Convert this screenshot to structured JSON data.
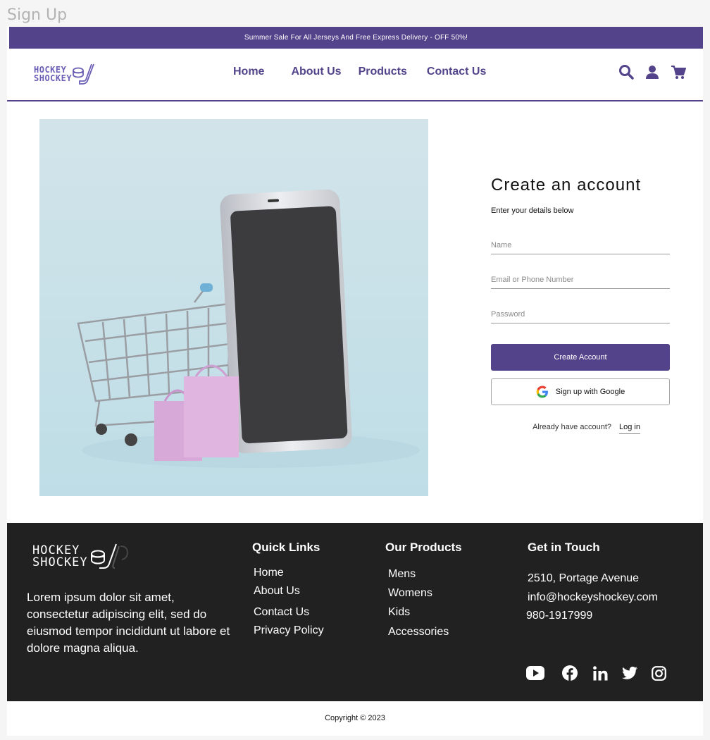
{
  "frame_label": "Sign Up",
  "promo": {
    "text": "Summer Sale For All Jerseys And Free Express Delivery - OFF 50%!"
  },
  "brand": {
    "line1": "HOCKEY",
    "line2": "SHOCKEY",
    "color": "#52438a"
  },
  "nav": [
    {
      "label": "Home"
    },
    {
      "label": "About Us"
    },
    {
      "label": "Products"
    },
    {
      "label": "Contact Us"
    }
  ],
  "header_icons": [
    "search-icon",
    "user-icon",
    "cart-icon"
  ],
  "signup": {
    "title": "Create an account",
    "subtitle": "Enter your details below",
    "name_placeholder": "Name",
    "email_placeholder": "Email or Phone Number",
    "password_placeholder": "Password",
    "create_button": "Create Account",
    "google_button": "Sign up with Google",
    "login_prompt": "Already have account?",
    "login_link": "Log in"
  },
  "footer": {
    "description": "Lorem ipsum dolor sit amet, consectetur adipiscing elit, sed do eiusmod tempor incididunt ut labore et dolore magna aliqua.",
    "quick_links": {
      "title": "Quick Links",
      "items": [
        "Home",
        "About Us",
        "Contact Us",
        "Privacy Policy"
      ]
    },
    "products": {
      "title": "Our Products",
      "items": [
        "Mens",
        "Womens",
        "Kids",
        "Accessories"
      ]
    },
    "contact": {
      "title": "Get in Touch",
      "address": "2510, Portage Avenue",
      "email": "info@hockeyshockey.com",
      "phone": "980-1917999"
    },
    "social": [
      "youtube-icon",
      "facebook-icon",
      "linkedin-icon",
      "twitter-icon",
      "instagram-icon"
    ],
    "background": "#212121"
  },
  "copyright": "Copyright © 2023"
}
